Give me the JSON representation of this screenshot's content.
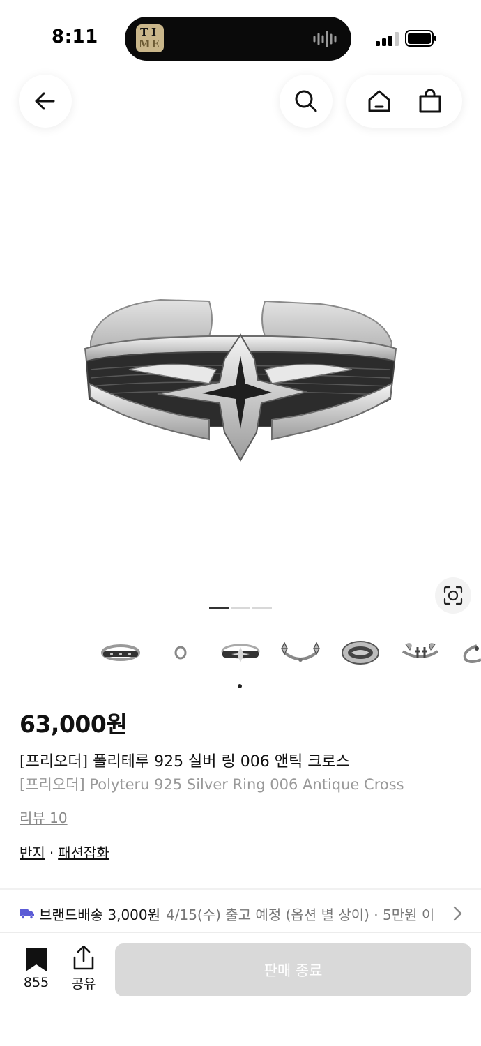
{
  "status_bar": {
    "time": "8:11",
    "island_app_letters": [
      "T",
      "I",
      "M",
      "E"
    ]
  },
  "header": {
    "icons": {
      "back": "arrow-left-icon",
      "search": "search-icon",
      "home": "home-icon",
      "cart": "shopping-bag-icon"
    }
  },
  "gallery": {
    "page_count": 3,
    "active_page": 1,
    "lens_icon": "visual-search-icon",
    "thumbnails": [
      "thin-band-ring",
      "small-ring",
      "cross-ring",
      "floral-cross-ring",
      "signet-ring",
      "double-cross-ring",
      "partial-ring"
    ]
  },
  "product": {
    "price": "63,000원",
    "title_ko": "[프리오더] 폴리테루 925 실버 링 006 앤틱 크로스",
    "title_en": "[프리오더] Polyteru 925 Silver Ring 006 Antique Cross",
    "review": "리뷰 10",
    "category_1": "반지",
    "category_sep": "·",
    "category_2": "패션잡화"
  },
  "shipping": {
    "label": "브랜드배송 3,000원",
    "detail": "4/15(수) 출고 예정 (옵션 별 상이) · 5만원 이",
    "icon": "truck-icon",
    "accent": "#5b5bd6"
  },
  "bottom_bar": {
    "bookmark_count": "855",
    "share_label": "공유",
    "buy_label": "판매 종료"
  }
}
